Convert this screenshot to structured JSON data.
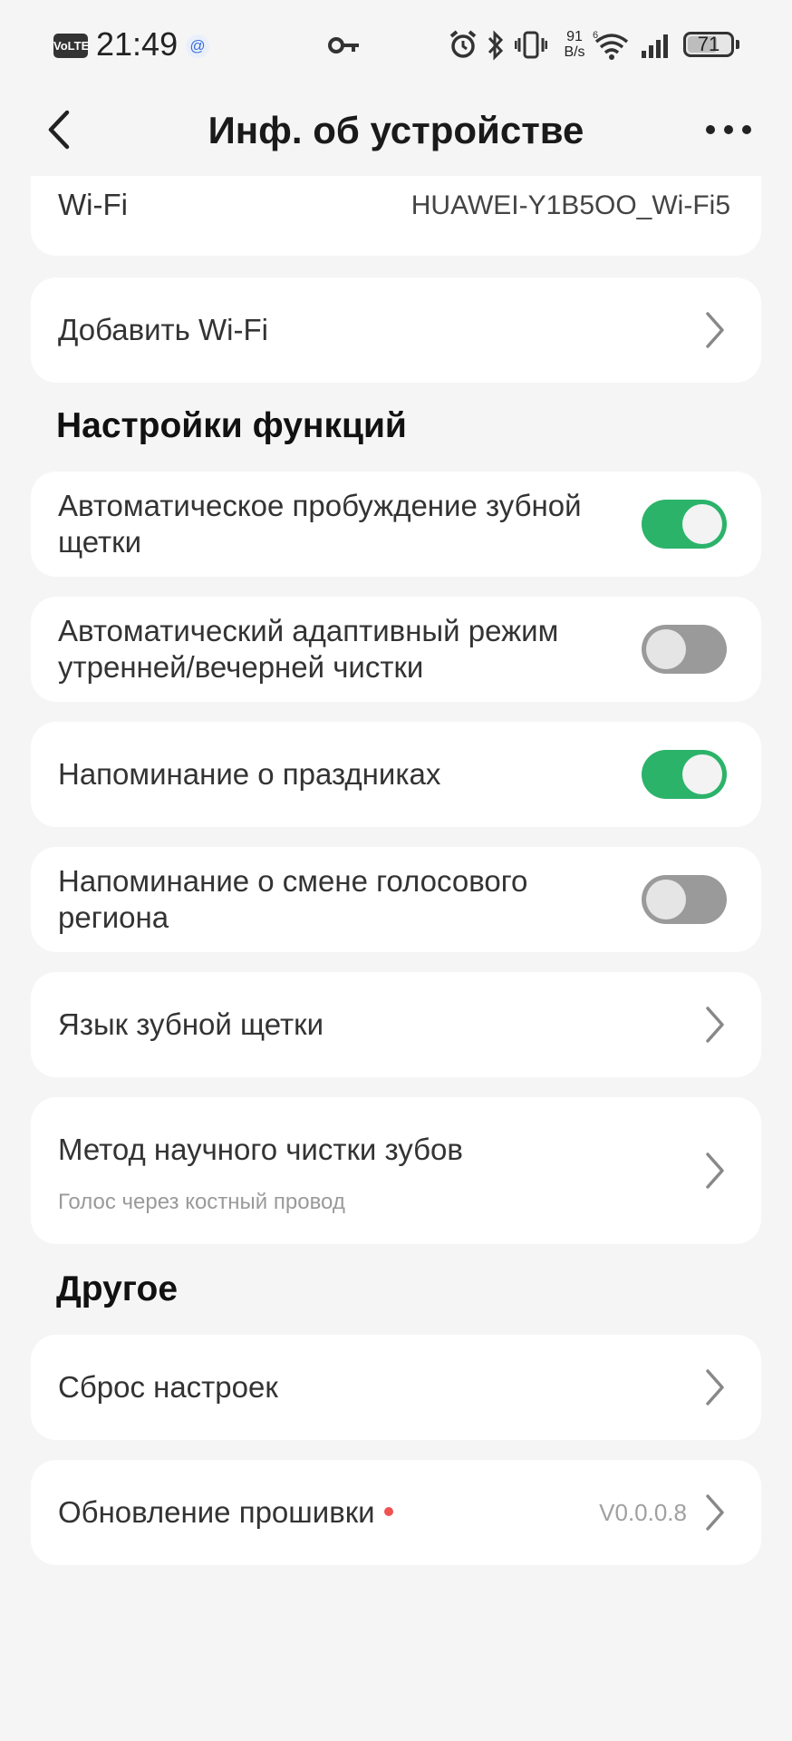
{
  "status_bar": {
    "volte": "VoLTE",
    "time": "21:49",
    "at_symbol": "@",
    "net_speed_value": "91",
    "net_speed_unit": "B/s",
    "battery": "71",
    "battery_level_percent": 71
  },
  "header": {
    "title": "Инф. об устройстве"
  },
  "wifi_row": {
    "label": "Wi-Fi",
    "value": "HUAWEI-Y1B5OO_Wi-Fi5"
  },
  "add_wifi": {
    "label": "Добавить Wi-Fi"
  },
  "sections": {
    "functions_title": "Настройки функций",
    "other_title": "Другое"
  },
  "functions": {
    "auto_wake": {
      "line1": "Автоматическое пробуждение зубной",
      "line2": "щетки",
      "enabled": true
    },
    "auto_adaptive": {
      "line1": "Автоматический адаптивный режим",
      "line2": "утренней/вечерней чистки",
      "enabled": false
    },
    "holiday_reminder": {
      "label": "Напоминание о праздниках",
      "enabled": true
    },
    "voice_region_reminder": {
      "line1": "Напоминание о смене голосового",
      "line2": "региона",
      "enabled": false
    },
    "brush_language": {
      "label": "Язык зубной щетки"
    },
    "scientific_method": {
      "label": "Метод научного чистки зубов",
      "sub": "Голос через костный провод"
    }
  },
  "other": {
    "reset": {
      "label": "Сброс настроек"
    },
    "firmware": {
      "label": "Обновление прошивки",
      "version": "V0.0.0.8"
    }
  },
  "colors": {
    "toggle_on": "#2bb36a",
    "toggle_off": "#9a9a9a",
    "update_dot": "#f05252"
  }
}
